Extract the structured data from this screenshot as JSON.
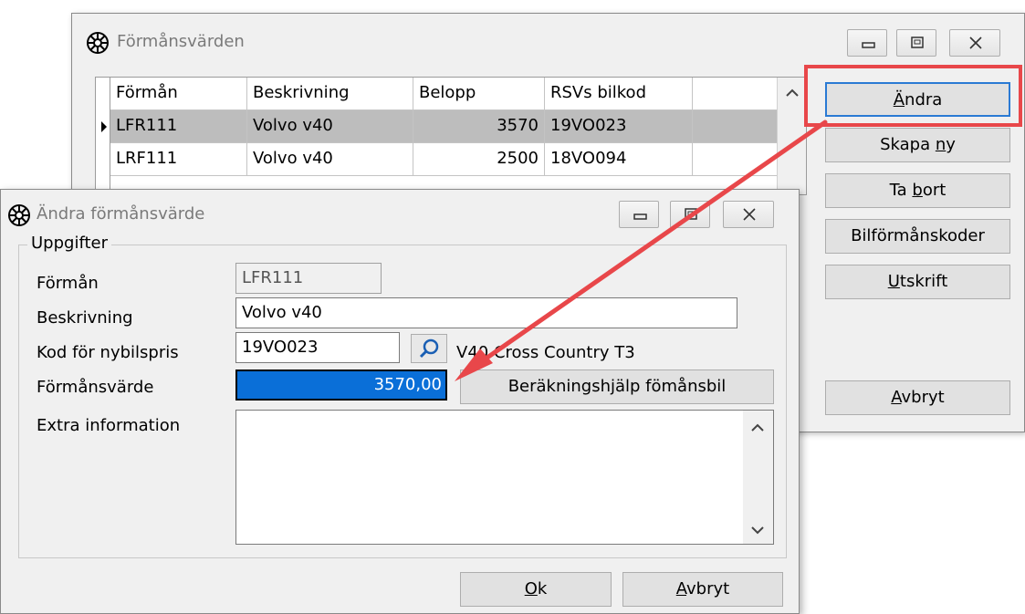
{
  "back_window": {
    "title": "Förmånsvärden",
    "columns": [
      "Förmån",
      "Beskrivning",
      "Belopp",
      "RSVs bilkod"
    ],
    "rows": [
      {
        "forman": "LFR111",
        "beskrivning": "Volvo v40",
        "belopp": "3570",
        "bilkod": "19VO023"
      },
      {
        "forman": "LRF111",
        "beskrivning": "Volvo v40",
        "belopp": "2500",
        "bilkod": "18VO094"
      }
    ],
    "buttons": {
      "andra": {
        "pre": "",
        "u": "Ä",
        "post": "ndra"
      },
      "skapa_ny": {
        "pre": "Skapa ",
        "u": "n",
        "post": "y"
      },
      "ta_bort": {
        "pre": "Ta ",
        "u": "b",
        "post": "ort"
      },
      "bilformanskoder": "Bilförmånskoder",
      "utskrift": {
        "pre": "",
        "u": "U",
        "post": "tskrift"
      },
      "avbryt": {
        "pre": "",
        "u": "A",
        "post": "vbryt"
      }
    },
    "highlight_color": "#e8474a"
  },
  "dialog": {
    "title": "Ändra förmånsvärde",
    "group_label": "Uppgifter",
    "labels": {
      "forman": "Förmån",
      "beskrivning": "Beskrivning",
      "kod": "Kod för nybilspris",
      "formansvarde": "Förmånsvärde",
      "extra": "Extra information"
    },
    "values": {
      "forman": "LFR111",
      "beskrivning": "Volvo v40",
      "kod": "19VO023",
      "kod_description": "V40 Cross Country T3",
      "formansvarde": "3570,00",
      "extra": ""
    },
    "buttons": {
      "berakning": "Beräkningshjälp fömånsbil",
      "ok": {
        "pre": "",
        "u": "O",
        "post": "k"
      },
      "avbryt": {
        "pre": "",
        "u": "A",
        "post": "vbryt"
      }
    }
  }
}
